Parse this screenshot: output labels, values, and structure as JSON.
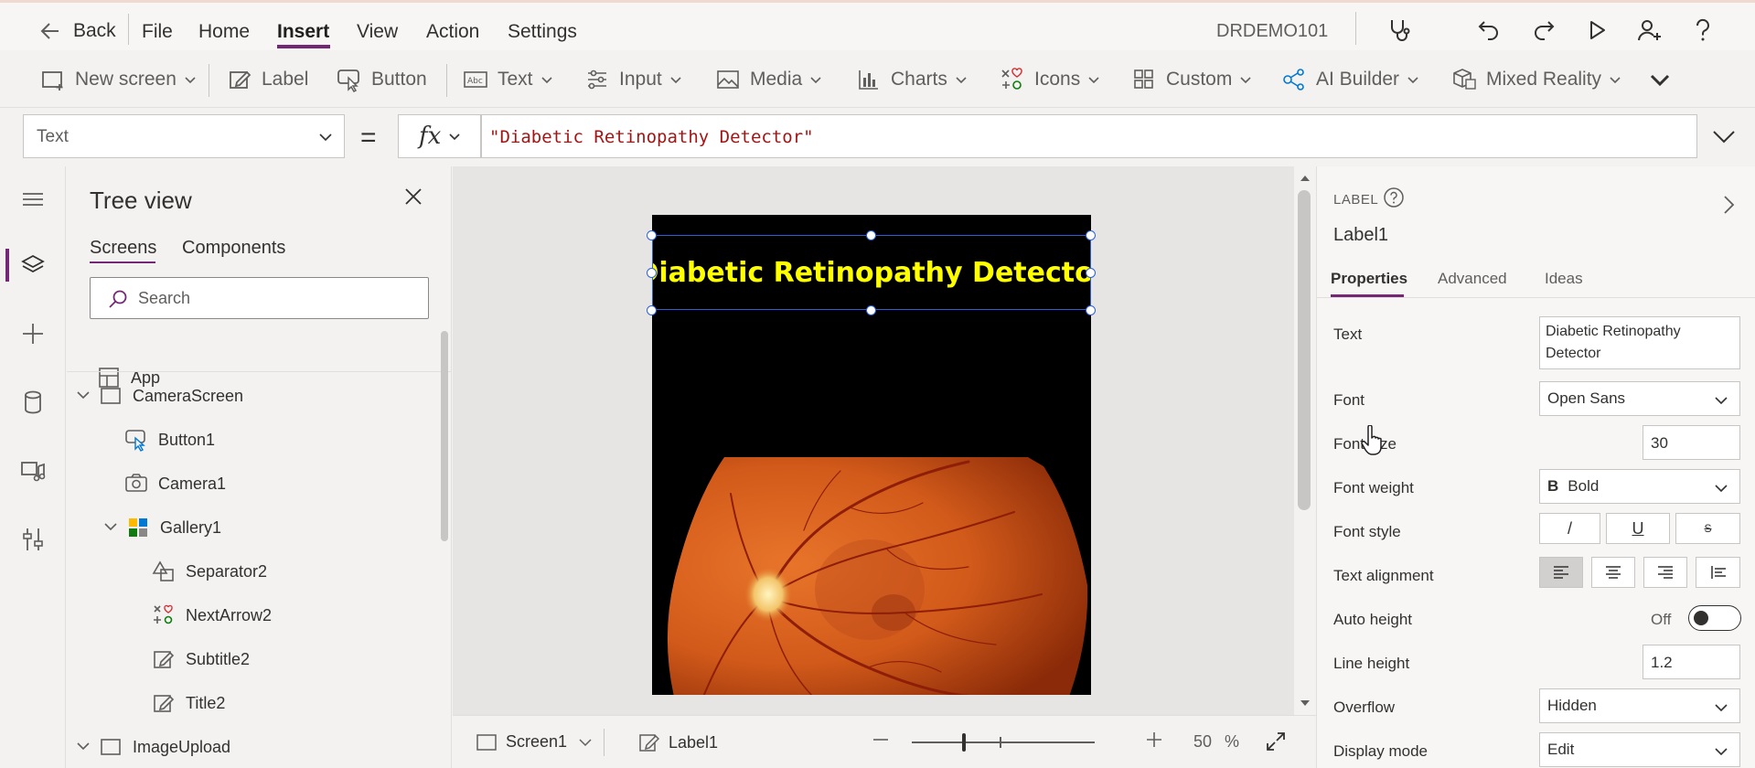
{
  "menubar": {
    "back": "Back",
    "items": [
      "File",
      "Home",
      "Insert",
      "View",
      "Action",
      "Settings"
    ],
    "active": "Insert",
    "environment": "DRDEMO101"
  },
  "ribbon": {
    "new_screen": "New screen",
    "label": "Label",
    "button": "Button",
    "text": "Text",
    "input": "Input",
    "media": "Media",
    "charts": "Charts",
    "icons": "Icons",
    "custom": "Custom",
    "ai_builder": "AI Builder",
    "mixed_reality": "Mixed Reality"
  },
  "formula": {
    "property": "Text",
    "equals": "=",
    "fx": "fx",
    "expression": "\"Diabetic Retinopathy Detector\""
  },
  "tree": {
    "title": "Tree view",
    "tabs": [
      "Screens",
      "Components"
    ],
    "search_placeholder": "Search",
    "nodes": [
      "App",
      "CameraScreen",
      "Button1",
      "Camera1",
      "Gallery1",
      "Separator2",
      "NextArrow2",
      "Subtitle2",
      "Title2",
      "ImageUpload"
    ]
  },
  "canvas": {
    "label_text": "Diabetic Retinopathy Detector"
  },
  "statusbar": {
    "screen": "Screen1",
    "control": "Label1",
    "zoom": "50",
    "zoom_unit": "%"
  },
  "properties": {
    "type": "LABEL",
    "name": "Label1",
    "tabs": [
      "Properties",
      "Advanced",
      "Ideas"
    ],
    "labels": {
      "text": "Text",
      "font": "Font",
      "font_size": "Font size",
      "font_weight": "Font weight",
      "font_style": "Font style",
      "text_alignment": "Text alignment",
      "auto_height": "Auto height",
      "line_height": "Line height",
      "overflow": "Overflow",
      "display_mode": "Display mode"
    },
    "values": {
      "text": "Diabetic Retinopathy Detector",
      "font": "Open Sans",
      "font_size": "30",
      "font_weight": "Bold",
      "font_weight_glyph": "B",
      "auto_height": "Off",
      "line_height": "1.2",
      "overflow": "Hidden",
      "display_mode": "Edit"
    },
    "style_glyphs": [
      "/",
      "U",
      "S"
    ]
  },
  "colors": {
    "accent": "#742774",
    "selection": "#2c5fd6",
    "label_text": "#ffff00",
    "formula_string": "#a31515"
  }
}
